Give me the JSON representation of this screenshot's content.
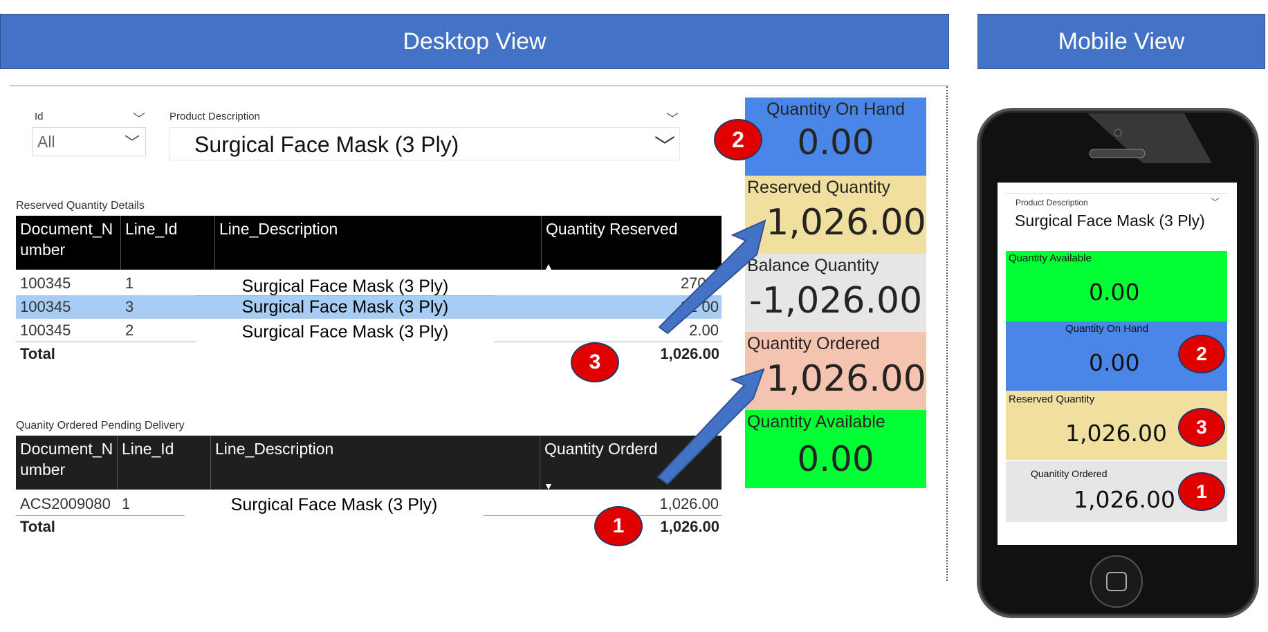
{
  "banners": {
    "desktop": "Desktop View",
    "mobile": "Mobile View"
  },
  "slicers": {
    "id": {
      "label": "Id",
      "value": "All"
    },
    "product": {
      "label": "Product Description",
      "value": "Surgical Face Mask (3 Ply)"
    }
  },
  "reserved_table": {
    "title": "Reserved Quantity Details",
    "headers": [
      "Document_N umber",
      "Line_Id",
      "Line_Description",
      "Quantity Reserved"
    ],
    "rows": [
      {
        "doc": "100345",
        "line": "1",
        "desc": "Surgical Face Mask (3 Ply)",
        "qty": "270.0"
      },
      {
        "doc": "100345",
        "line": "3",
        "desc": "Surgical Face Mask (3 Ply)",
        "qty": "32  00"
      },
      {
        "doc": "100345",
        "line": "2",
        "desc": "Surgical Face Mask (3 Ply)",
        "qty": "2.00"
      }
    ],
    "total_label": "Total",
    "total_value": "1,026.00"
  },
  "ordered_table": {
    "title": "Quanity Ordered Pending Delivery",
    "headers": [
      "Document_N umber",
      "Line_Id",
      "Line_Description",
      "Quantity Orderd"
    ],
    "rows": [
      {
        "doc": "ACS2009080",
        "line": "1",
        "desc": "Surgical Face Mask (3 Ply)",
        "qty": "1,026.00"
      }
    ],
    "total_label": "Total",
    "total_value": "1,026.00"
  },
  "cards": {
    "on_hand": {
      "label": "Quantity On Hand",
      "value": "0.00",
      "color": "#4a86e8"
    },
    "reserved": {
      "label": "Reserved Quantity",
      "value": "1,026.00",
      "color": "#f0e0a0"
    },
    "balance": {
      "label": "Balance Quantity",
      "value": "-1,026.00",
      "color": "#e6e6e6"
    },
    "ordered": {
      "label": "Quantity Ordered",
      "value": "1,026.00",
      "color": "#f4c4b0"
    },
    "available": {
      "label": "Quantity Available",
      "value": "0.00",
      "color": "#00ff33"
    }
  },
  "badges": {
    "one": "1",
    "two": "2",
    "three": "3"
  },
  "mobile": {
    "product_label": "Product Description",
    "product_value": "Surgical Face Mask (3 Ply)",
    "available": {
      "label": "Quantity Available",
      "value": "0.00"
    },
    "on_hand": {
      "label": "Quantity On Hand",
      "value": "0.00"
    },
    "reserved": {
      "label": "Reserved Quantity",
      "value": "1,026.00"
    },
    "ordered": {
      "label": "Quanitity Ordered",
      "value": "1,026.00"
    }
  }
}
